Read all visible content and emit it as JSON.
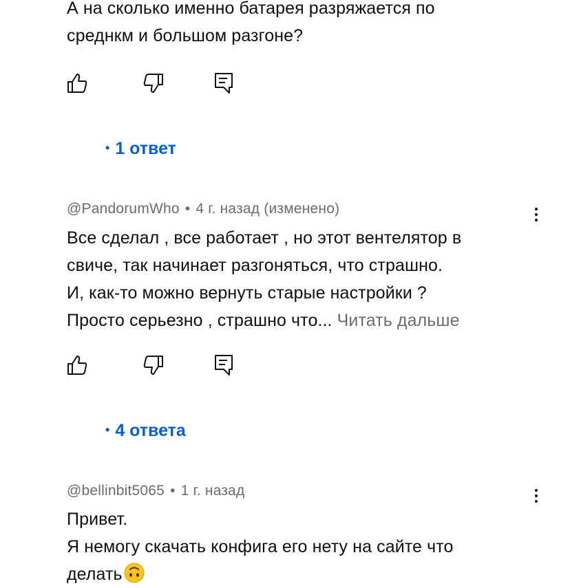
{
  "comment1": {
    "text_lines": [
      "А на сколько именно батарея разряжается по",
      "среднкм и большом разгоне?"
    ],
    "replies_label": "1 ответ"
  },
  "comment2": {
    "author": "@PandorumWho",
    "time": "4 г. назад (изменено)",
    "text_lines": [
      "Все сделал , все работает , но этот вентелятор в",
      "свиче, так начинает разгоняться,  что страшно.",
      "И, как-то можно вернуть  старые настройки ?",
      "Просто  серьезно , страшно что..."
    ],
    "read_more": "Читать дальше",
    "replies_label": "4 ответа"
  },
  "comment3": {
    "author": "@bellinbit5065",
    "time": "1 г. назад",
    "text_lines": [
      "Привет.",
      "Я немогу скачать конфига его нету на сайте что",
      "делать"
    ]
  },
  "icons": {
    "like": "thumbs-up-icon",
    "dislike": "thumbs-down-icon",
    "reply": "reply-comment-icon",
    "more": "more-vertical-icon",
    "emoji": "upside-down-face-emoji"
  },
  "colors": {
    "text": "#0f0f0f",
    "secondary": "#6b6b6b",
    "link": "#065fd4"
  }
}
